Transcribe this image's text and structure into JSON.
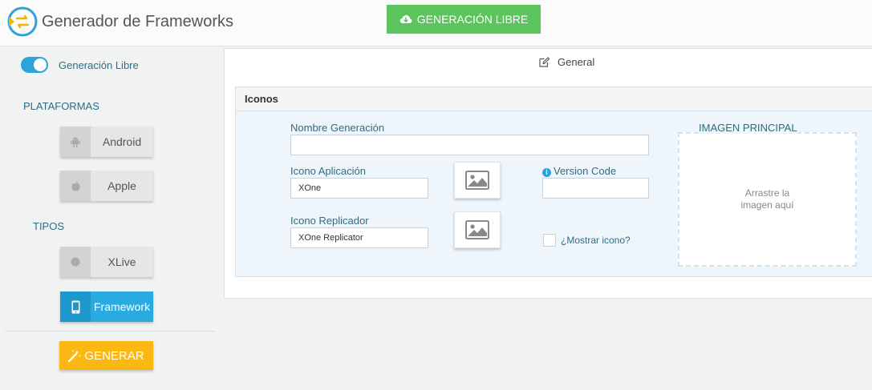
{
  "header": {
    "app_title": "Generador de Frameworks",
    "free_generation_button": "GENERACIÓN LIBRE",
    "accent_color": "#5cc45c"
  },
  "sidebar": {
    "toggle_label": "Generación Libre",
    "toggle_on": true,
    "platforms_title": "PLATAFORMAS",
    "platforms": [
      {
        "label": "Android",
        "icon": "android-icon"
      },
      {
        "label": "Apple",
        "icon": "apple-icon"
      }
    ],
    "types_title": "TIPOS",
    "types": [
      {
        "label": "XLive",
        "icon": "circle-icon",
        "active": false
      },
      {
        "label": "Framework",
        "icon": "mobile-icon",
        "active": true
      }
    ],
    "generate_button": "GENERAR",
    "generate_color": "#fbb812",
    "active_color": "#29abe2"
  },
  "main": {
    "tab_label": "General",
    "section_title": "Iconos",
    "fields": {
      "nombre_label": "Nombre Generación",
      "nombre_value": "",
      "icono_app_label": "Icono Aplicación",
      "icono_app_value": "XOne",
      "icono_repl_label": "Icono Replicador",
      "icono_repl_value": "XOne Replicator",
      "version_code_label": "Version Code",
      "version_code_value": "",
      "mostrar_icono_label": "¿Mostrar icono?",
      "mostrar_icono_checked": false
    },
    "dropzone": {
      "title": "IMAGEN PRINCIPAL",
      "text_line1": "Arrastre la",
      "text_line2": "imagen aquí"
    }
  }
}
